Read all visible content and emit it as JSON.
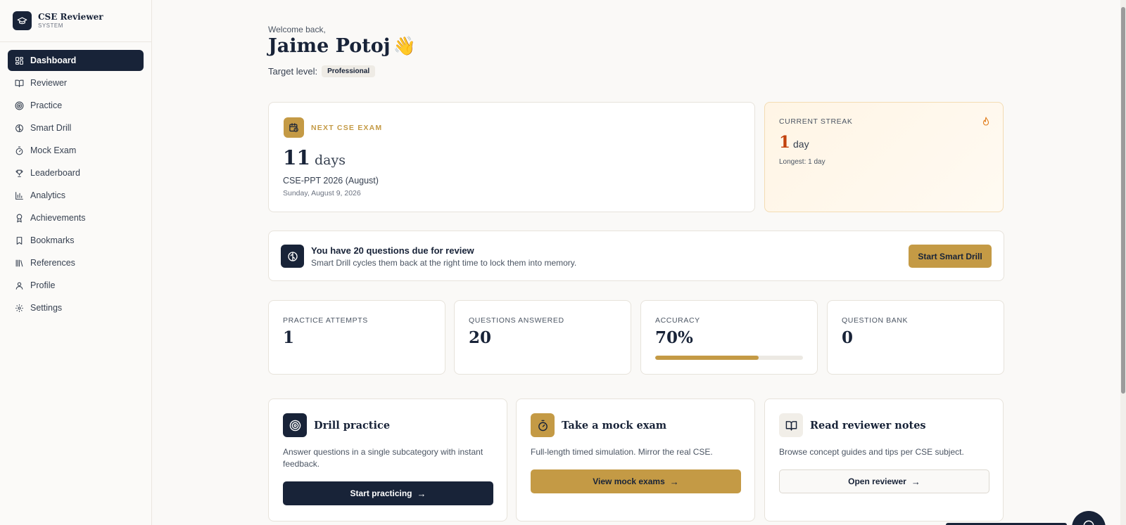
{
  "brand": {
    "title": "CSE Reviewer",
    "subtitle": "SYSTEM",
    "icon": "graduation-cap-icon"
  },
  "sidebar": {
    "items": [
      {
        "label": "Dashboard",
        "icon": "grid-icon",
        "active": true
      },
      {
        "label": "Reviewer",
        "icon": "book-open-icon"
      },
      {
        "label": "Practice",
        "icon": "target-icon"
      },
      {
        "label": "Smart Drill",
        "icon": "brain-icon"
      },
      {
        "label": "Mock Exam",
        "icon": "timer-icon"
      },
      {
        "label": "Leaderboard",
        "icon": "trophy-icon"
      },
      {
        "label": "Analytics",
        "icon": "bar-chart-icon"
      },
      {
        "label": "Achievements",
        "icon": "award-icon"
      },
      {
        "label": "Bookmarks",
        "icon": "bookmark-icon"
      },
      {
        "label": "References",
        "icon": "library-icon"
      },
      {
        "label": "Profile",
        "icon": "user-icon"
      },
      {
        "label": "Settings",
        "icon": "gear-icon"
      }
    ]
  },
  "header": {
    "welcome": "Welcome back,",
    "name": "Jaime Potoj",
    "wave": "👋",
    "target_label": "Target level:",
    "target_value": "Professional"
  },
  "exam": {
    "label": "NEXT CSE EXAM",
    "days_num": "11",
    "days_unit": "days",
    "name": "CSE-PPT 2026 (August)",
    "date": "Sunday, August 9, 2026",
    "icon": "calendar-clock-icon"
  },
  "streak": {
    "label": "CURRENT STREAK",
    "value": "1",
    "unit": "day",
    "longest": "Longest: 1 day",
    "icon": "flame-icon"
  },
  "review": {
    "title": "You have 20 questions due for review",
    "subtitle": "Smart Drill cycles them back at the right time to lock them into memory.",
    "button": "Start Smart Drill",
    "icon": "brain-icon"
  },
  "stats": [
    {
      "label": "PRACTICE ATTEMPTS",
      "value": "1"
    },
    {
      "label": "QUESTIONS ANSWERED",
      "value": "20"
    },
    {
      "label": "ACCURACY",
      "value": "70%",
      "progress": 0.7
    },
    {
      "label": "QUESTION BANK",
      "value": "0"
    }
  ],
  "actions": [
    {
      "title": "Drill practice",
      "desc": "Answer questions in a single subcategory with instant feedback.",
      "button": "Start practicing",
      "icon": "target-icon"
    },
    {
      "title": "Take a mock exam",
      "desc": "Full-length timed simulation. Mirror the real CSE.",
      "button": "View mock exams",
      "icon": "timer-icon"
    },
    {
      "title": "Read reviewer notes",
      "desc": "Browse concept guides and tips per CSE subject.",
      "button": "Open reviewer",
      "icon": "book-open-icon"
    }
  ],
  "colors": {
    "navy": "#182338",
    "gold": "#c49a45",
    "streak": "#c2410c",
    "background": "#faf9f7"
  }
}
